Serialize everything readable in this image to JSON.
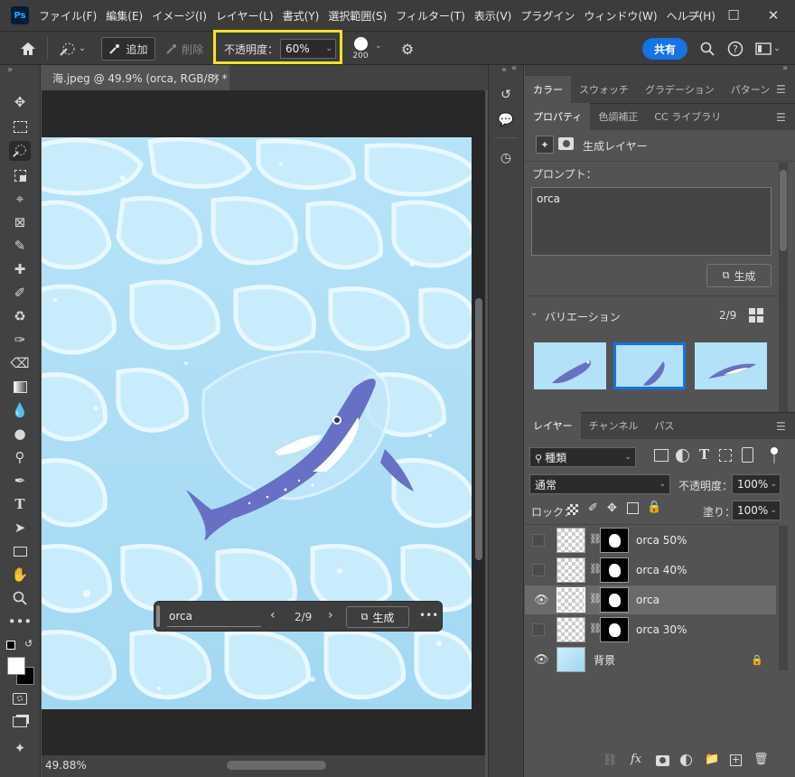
{
  "menubar": {
    "items": [
      "ファイル(F)",
      "編集(E)",
      "イメージ(I)",
      "レイヤー(L)",
      "書式(Y)",
      "選択範囲(S)",
      "フィルター(T)",
      "表示(V)",
      "プラグイン",
      "ウィンドウ(W)",
      "ヘルプ(H)"
    ],
    "logo": "Ps"
  },
  "options": {
    "add_label": "追加",
    "delete_label": "削除",
    "opacity_label": "不透明度：",
    "opacity_value": "60%",
    "brush_size": "200",
    "share_label": "共有"
  },
  "document": {
    "tab_title": "海.jpeg @ 49.9% (orca, RGB/8) *",
    "zoom": "49.88%"
  },
  "floating_bar": {
    "prompt": "orca",
    "counter": "2/9",
    "generate_label": "生成"
  },
  "top_tabs": [
    "カラー",
    "スウォッチ",
    "グラデーション",
    "パターン"
  ],
  "props_tabs": [
    "プロパティ",
    "色調補正",
    "CC ライブラリ"
  ],
  "properties": {
    "layer_type": "生成レイヤー",
    "prompt_label": "プロンプト：",
    "prompt_value": "orca",
    "generate_label": "生成",
    "variations_label": "バリエーション",
    "variations_count": "2/9"
  },
  "layers_tabs": [
    "レイヤー",
    "チャンネル",
    "パス"
  ],
  "layers": {
    "filter_kind": "種類",
    "blend_mode": "通常",
    "opacity_label": "不透明度：",
    "opacity_value": "100%",
    "lock_label": "ロック：",
    "fill_label": "塗り：",
    "fill_value": "100%",
    "items": [
      {
        "name": "orca 50%",
        "visible": false
      },
      {
        "name": "orca 40%",
        "visible": false
      },
      {
        "name": "orca",
        "visible": true,
        "selected": true
      },
      {
        "name": "orca 30%",
        "visible": false
      },
      {
        "name": "背景",
        "visible": true,
        "locked": true
      }
    ]
  },
  "colors": {
    "accent": "#1473e6",
    "highlight": "#f5e41a",
    "water": "#a9dcf6",
    "orca": "#6770c4"
  }
}
